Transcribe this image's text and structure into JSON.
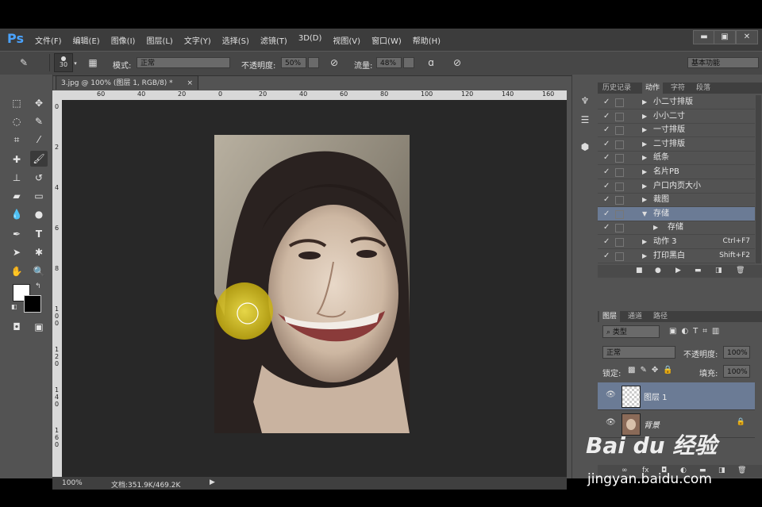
{
  "menubar": {
    "logo": "Ps",
    "items": [
      "文件(F)",
      "编辑(E)",
      "图像(I)",
      "图层(L)",
      "文字(Y)",
      "选择(S)",
      "滤镜(T)",
      "3D(D)",
      "视图(V)",
      "窗口(W)",
      "帮助(H)"
    ],
    "window_buttons": [
      "▬",
      "▣",
      "✕"
    ]
  },
  "options": {
    "brush_size": "30",
    "mode_label": "模式:",
    "mode_value": "正常",
    "opacity_label": "不透明度:",
    "opacity_value": "50%",
    "flow_label": "流量:",
    "flow_value": "48%",
    "workspace": "基本功能"
  },
  "document": {
    "tab_title": "3.jpg @ 100% (图层 1, RGB/8) *",
    "tab_close": "×",
    "ruler_h": [
      "60",
      "40",
      "20",
      "0",
      "20",
      "40",
      "60",
      "80",
      "100",
      "120",
      "140",
      "160"
    ],
    "ruler_v": [
      "0",
      "2",
      "4",
      "6",
      "8",
      "1\n0\n0",
      "1\n2\n0",
      "1\n4\n0",
      "1\n6\n0"
    ],
    "zoom": "100%",
    "doc_size": "文档:351.9K/469.2K"
  },
  "actions_panel": {
    "tabs": [
      "历史记录",
      "动作",
      "字符",
      "段落"
    ],
    "active_tab": "动作",
    "rows": [
      {
        "name": "小二寸排版",
        "key": "",
        "expanded": false,
        "selected": false
      },
      {
        "name": "小小二寸",
        "key": "",
        "expanded": false,
        "selected": false
      },
      {
        "name": "一寸排版",
        "key": "",
        "expanded": false,
        "selected": false
      },
      {
        "name": "二寸排版",
        "key": "",
        "expanded": false,
        "selected": false
      },
      {
        "name": "纸条",
        "key": "",
        "expanded": false,
        "selected": false
      },
      {
        "name": "名片PB",
        "key": "",
        "expanded": false,
        "selected": false
      },
      {
        "name": "户口内页大小",
        "key": "",
        "expanded": false,
        "selected": false
      },
      {
        "name": "裁图",
        "key": "",
        "expanded": false,
        "selected": false
      },
      {
        "name": "存储",
        "key": "",
        "expanded": true,
        "selected": true
      },
      {
        "name": "存储",
        "key": "",
        "expanded": false,
        "selected": false,
        "child": true
      },
      {
        "name": "动作 3",
        "key": "Ctrl+F7",
        "expanded": false,
        "selected": false
      },
      {
        "name": "打印黑白",
        "key": "Shift+F2",
        "expanded": false,
        "selected": false
      }
    ]
  },
  "layers_panel": {
    "tabs": [
      "图层",
      "通道",
      "路径"
    ],
    "filter_kind": "类型",
    "blend_mode": "正常",
    "opacity_label": "不透明度:",
    "opacity_value": "100%",
    "lock_label": "锁定:",
    "fill_label": "填充:",
    "fill_value": "100%",
    "layers": [
      {
        "name": "图层 1",
        "selected": true
      },
      {
        "name": "背景",
        "selected": false
      }
    ]
  },
  "watermark": {
    "brand": "Bai du 经验",
    "url": "jingyan.baidu.com"
  },
  "colors": {
    "accent_selected": "#6b7b95",
    "brush_highlight": "#e6d21a",
    "ps_logo": "#4aa3ff"
  }
}
